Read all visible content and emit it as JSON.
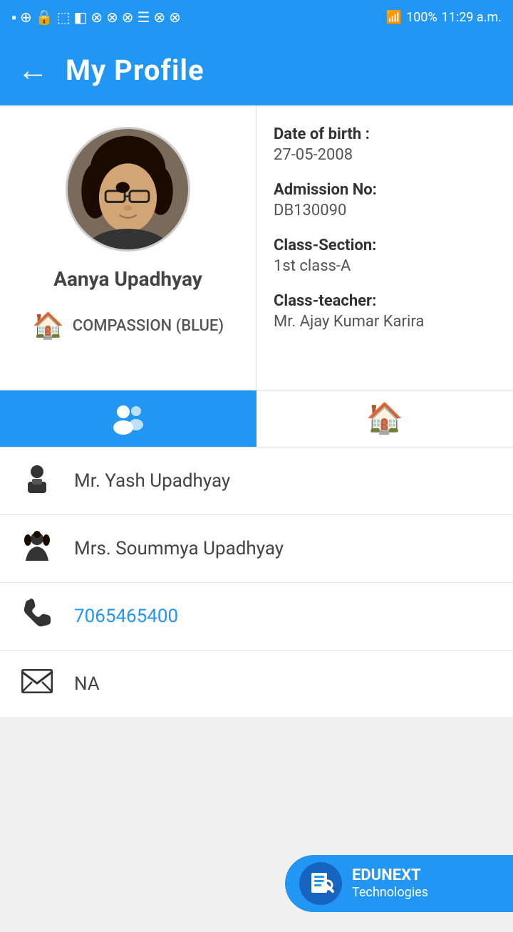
{
  "statusBar": {
    "time": "11:29 a.m.",
    "battery": "100%",
    "signal": "●●●●"
  },
  "appBar": {
    "title": "My Profile",
    "backIcon": "←"
  },
  "profile": {
    "name": "Aanya Upadhyay",
    "houseIcon": "🏠",
    "house": "COMPASSION (BLUE)",
    "dateOfBirthLabel": "Date of birth :",
    "dateOfBirth": "27-05-2008",
    "admissionNoLabel": "Admission No:",
    "admissionNo": "DB130090",
    "classSectionLabel": "Class-Section:",
    "classSection": "1st class-A",
    "classTeacherLabel": "Class-teacher:",
    "classTeacher": "Mr. Ajay Kumar Karira"
  },
  "tabs": [
    {
      "id": "family",
      "icon": "👥",
      "active": true
    },
    {
      "id": "home",
      "icon": "🏠",
      "active": false
    }
  ],
  "familyList": [
    {
      "id": "father",
      "icon": "👨‍💼",
      "text": "Mr. Yash  Upadhyay",
      "color": "normal"
    },
    {
      "id": "mother",
      "icon": "👩",
      "text": "Mrs. Soummya  Upadhyay",
      "color": "normal"
    },
    {
      "id": "phone",
      "icon": "📞",
      "text": "7065465400",
      "color": "blue"
    },
    {
      "id": "email",
      "icon": "✉",
      "text": "NA",
      "color": "normal"
    }
  ],
  "brand": {
    "name": "EDUNEXT",
    "sub": "Technologies"
  }
}
